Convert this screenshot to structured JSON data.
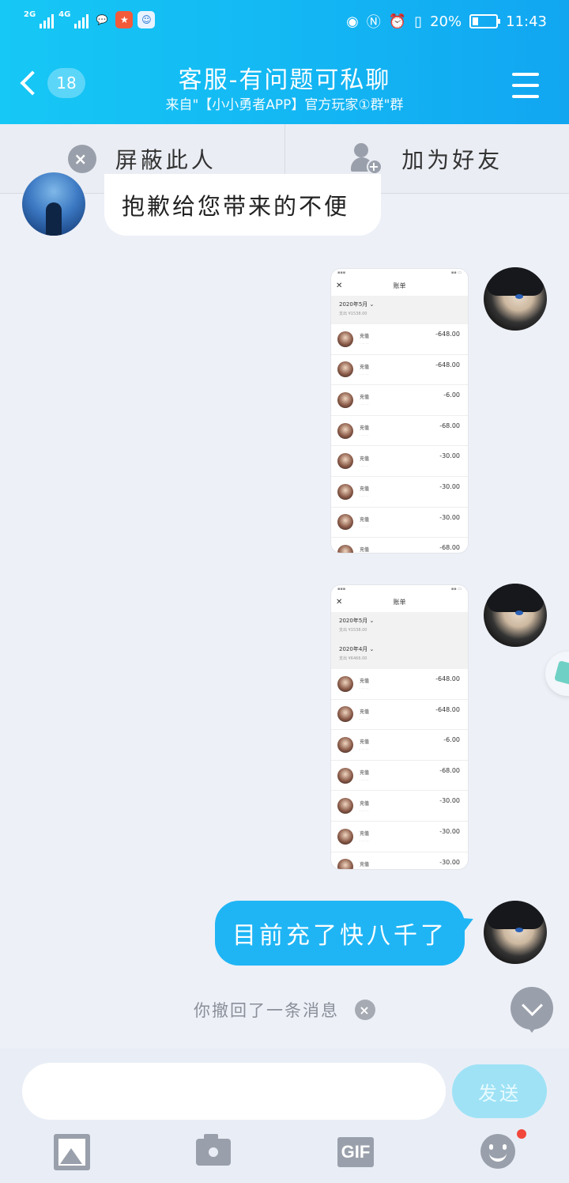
{
  "status_bar": {
    "network1": "2G",
    "network2": "4G",
    "battery_percent": "20%",
    "time": "11:43",
    "icons": [
      "signal-icon",
      "message-app-icon",
      "game-app-icon",
      "assistant-app-icon",
      "eye-icon",
      "nfc-icon",
      "alarm-icon",
      "vibrate-icon"
    ]
  },
  "header": {
    "back_icon": "chevron-left-icon",
    "unread_count": "18",
    "title": "客服-有问题可私聊",
    "subtitle": "来自\"【小小勇者APP】官方玩家①群\"群",
    "menu_icon": "hamburger-icon"
  },
  "actions": {
    "block_label": "屏蔽此人",
    "add_friend_label": "加为好友"
  },
  "messages": {
    "incoming_text": "抱歉给您带来的不便",
    "outgoing_text": "目前充了快八千了",
    "recall_notice": "你撤回了一条消息"
  },
  "screenshots": [
    {
      "nav_title": "账单",
      "months": [
        {
          "label": "2020年5月 ⌄",
          "summary": "支出 ¥1538.00"
        }
      ],
      "rows": [
        {
          "label": "充值",
          "amount": "-648.00"
        },
        {
          "label": "充值",
          "amount": "-648.00"
        },
        {
          "label": "充值",
          "amount": "-6.00"
        },
        {
          "label": "充值",
          "amount": "-68.00"
        },
        {
          "label": "充值",
          "amount": "-30.00"
        },
        {
          "label": "充值",
          "amount": "-30.00"
        },
        {
          "label": "充值",
          "amount": "-30.00"
        },
        {
          "label": "充值",
          "amount": "-68.00"
        }
      ]
    },
    {
      "nav_title": "账单",
      "months": [
        {
          "label": "2020年5月 ⌄",
          "summary": "支出 ¥1538.00"
        },
        {
          "label": "2020年4月 ⌄",
          "summary": "支出 ¥6466.00"
        }
      ],
      "rows": [
        {
          "label": "充值",
          "amount": "-648.00"
        },
        {
          "label": "充值",
          "amount": "-648.00"
        },
        {
          "label": "充值",
          "amount": "-6.00"
        },
        {
          "label": "充值",
          "amount": "-68.00"
        },
        {
          "label": "充值",
          "amount": "-30.00"
        },
        {
          "label": "充值",
          "amount": "-30.00"
        },
        {
          "label": "充值",
          "amount": "-30.00"
        }
      ]
    }
  ],
  "input": {
    "placeholder": "",
    "send_label": "发送",
    "tools": [
      "image-icon",
      "camera-icon",
      "gif-icon",
      "emoji-icon"
    ],
    "gif_label": "GIF"
  },
  "colors": {
    "header_gradient_start": "#16c8f5",
    "header_gradient_end": "#12a6f1",
    "outgoing_bubble": "#1fb5f5",
    "send_button": "#9fe2f6",
    "notification_dot": "#f2483c"
  }
}
